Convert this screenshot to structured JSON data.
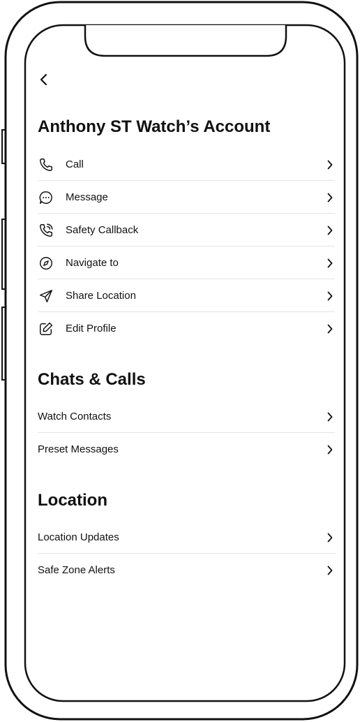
{
  "header": {
    "back_icon": "chevron-left-icon"
  },
  "account": {
    "title": "Anthony ST Watch’s Account",
    "items": [
      {
        "label": "Call",
        "icon": "phone-icon"
      },
      {
        "label": "Message",
        "icon": "message-bubble-icon"
      },
      {
        "label": "Safety Callback",
        "icon": "phone-callback-icon"
      },
      {
        "label": "Navigate to",
        "icon": "compass-icon"
      },
      {
        "label": "Share Location",
        "icon": "send-location-icon"
      },
      {
        "label": "Edit Profile",
        "icon": "edit-icon"
      }
    ]
  },
  "chats": {
    "title": "Chats & Calls",
    "items": [
      {
        "label": "Watch Contacts"
      },
      {
        "label": "Preset Messages"
      }
    ]
  },
  "location": {
    "title": "Location",
    "items": [
      {
        "label": "Location Updates"
      },
      {
        "label": "Safe Zone Alerts"
      }
    ]
  },
  "colors": {
    "text": "#111111",
    "divider": "#e4e4e4",
    "frame": "#111111"
  }
}
